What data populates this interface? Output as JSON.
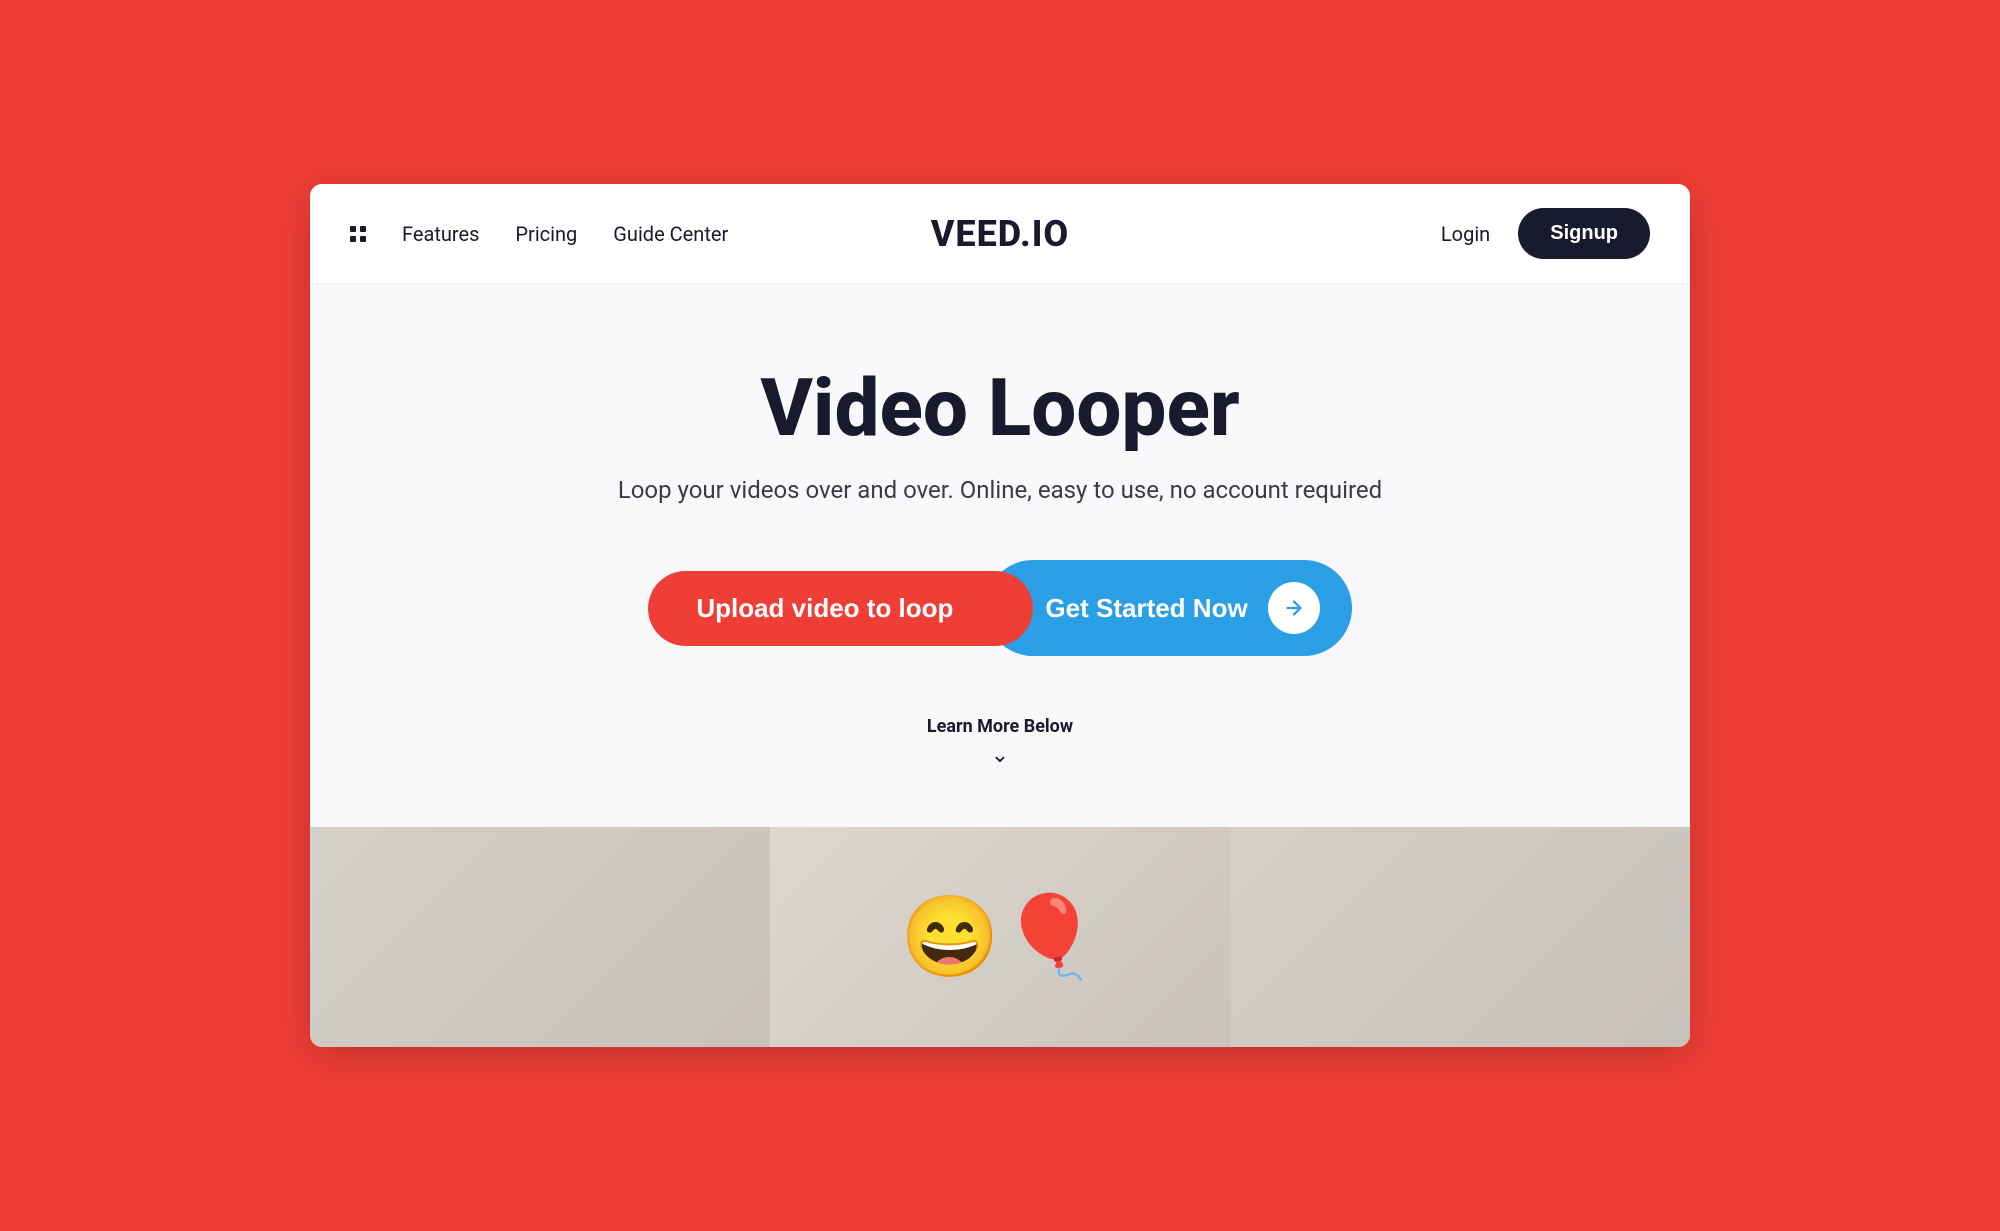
{
  "colors": {
    "brand_dark": "#1a1a2e",
    "brand_red": "#EF3E36",
    "brand_blue": "#2B9FE6",
    "white": "#ffffff"
  },
  "navbar": {
    "features_label": "Features",
    "pricing_label": "Pricing",
    "guide_label": "Guide Center",
    "logo": "VEED.IO",
    "login_label": "Login",
    "signup_label": "Signup"
  },
  "hero": {
    "title": "Video Looper",
    "subtitle": "Loop your videos over and over. Online, easy to use, no account required",
    "upload_label": "Upload video to loop",
    "get_started_label": "Get Started Now",
    "learn_more_label": "Learn More Below"
  }
}
